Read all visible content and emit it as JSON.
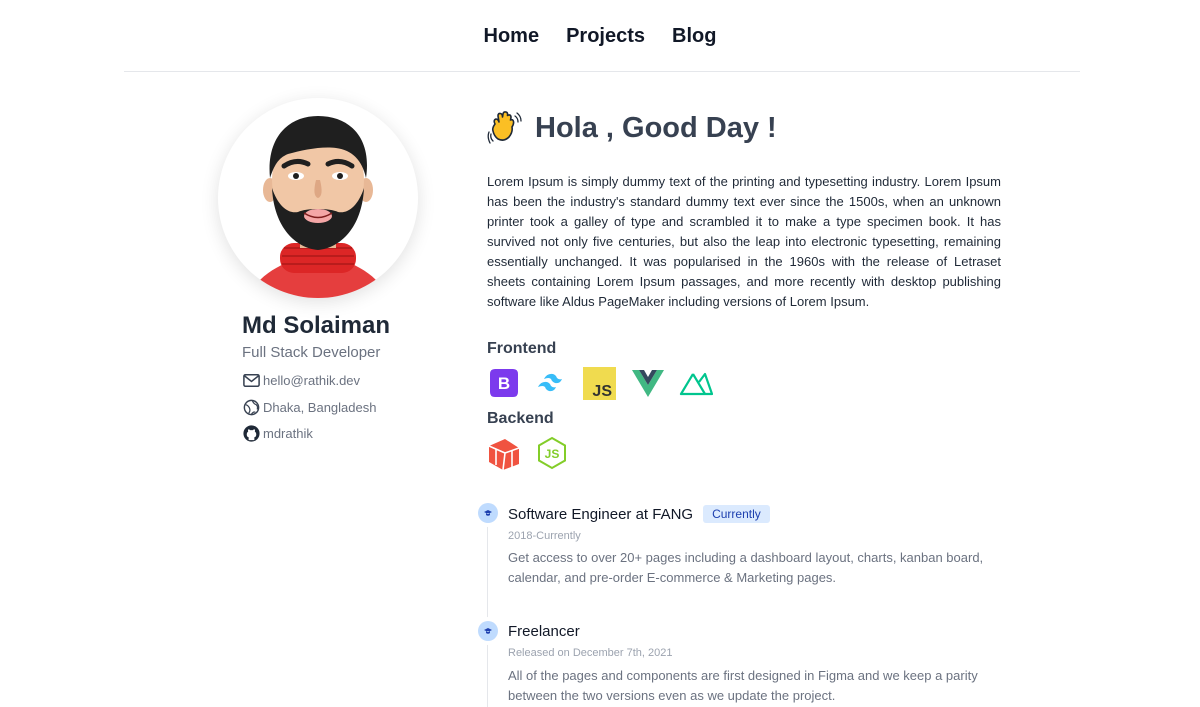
{
  "nav": {
    "items": [
      "Home",
      "Projects",
      "Blog"
    ]
  },
  "profile": {
    "name": "Md Solaiman",
    "role": "Full Stack Developer",
    "email": "hello@rathik.dev",
    "location": "Dhaka, Bangladesh",
    "github": "mdrathik"
  },
  "intro": {
    "greeting": "Hola , Good Day !",
    "paragraph": "Lorem Ipsum is simply dummy text of the printing and typesetting industry. Lorem Ipsum has been the industry's standard dummy text ever since the 1500s, when an unknown printer took a galley of type and scrambled it to make a type specimen book. It has survived not only five centuries, but also the leap into electronic typesetting, remaining essentially unchanged. It was popularised in the 1960s with the release of Letraset sheets containing Lorem Ipsum passages, and more recently with desktop publishing software like Aldus PageMaker including versions of Lorem Ipsum."
  },
  "skills": {
    "frontend_title": "Frontend",
    "frontend_icons": [
      "bootstrap-icon",
      "tailwind-icon",
      "javascript-icon",
      "vue-icon",
      "nuxt-icon"
    ],
    "backend_title": "Backend",
    "backend_icons": [
      "laravel-icon",
      "nodejs-icon"
    ],
    "colors": {
      "bootstrap": "#7c3aed",
      "tailwind": "#38bdf8",
      "javascript": "#f0db4f",
      "vue": "#41b883",
      "vue_dark": "#34495e",
      "nuxt": "#00c58e",
      "laravel": "#f05340",
      "nodejs": "#83cd29"
    }
  },
  "timeline": [
    {
      "title": "Software Engineer at FANG",
      "badge": "Currently",
      "date": "2018-Currently",
      "description": "Get access to over 20+ pages including a dashboard layout, charts, kanban board, calendar, and pre-order E-commerce & Marketing pages."
    },
    {
      "title": "Freelancer",
      "badge": "",
      "date": "Released on December 7th, 2021",
      "description": "All of the pages and components are first designed in Figma and we keep a parity between the two versions even as we update the project."
    }
  ]
}
